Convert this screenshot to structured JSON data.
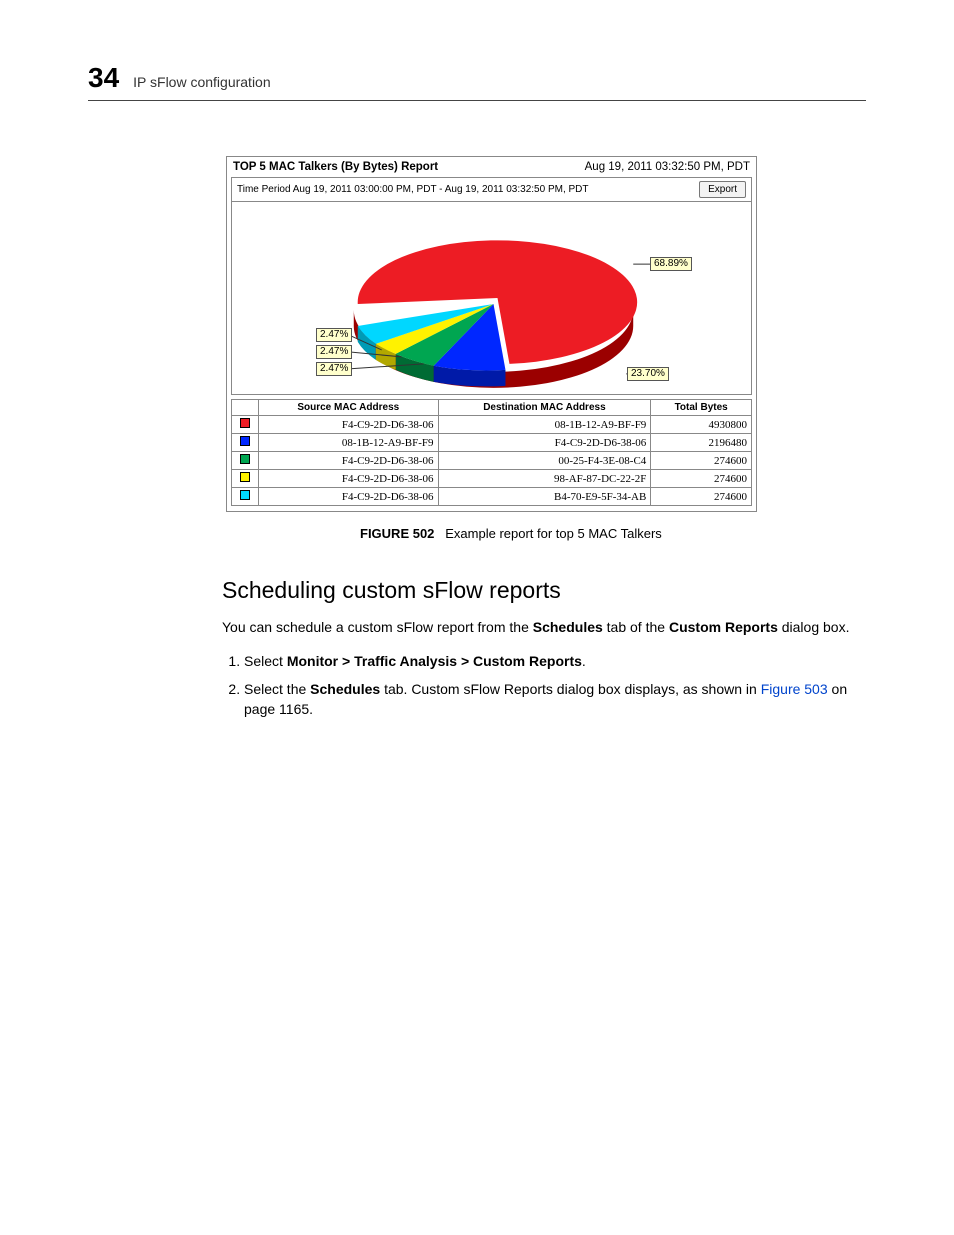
{
  "header": {
    "chapter": "34",
    "title": "IP sFlow configuration"
  },
  "report": {
    "title": "TOP 5 MAC Talkers (By Bytes) Report",
    "timestamp": "Aug 19, 2011 03:32:50 PM, PDT",
    "period": "Time Period Aug 19, 2011 03:00:00 PM, PDT - Aug 19, 2011 03:32:50 PM, PDT",
    "export": "Export"
  },
  "chart_data": {
    "type": "pie",
    "title": "TOP 5 MAC Talkers (By Bytes) Report",
    "slices": [
      {
        "label": "68.89%",
        "value": 68.89,
        "color": "#ed1c24"
      },
      {
        "label": "23.70%",
        "value": 23.7,
        "color": "#0027ff"
      },
      {
        "label": "2.47%",
        "value": 2.47,
        "color": "#00a651"
      },
      {
        "label": "2.47%",
        "value": 2.47,
        "color": "#fff200"
      },
      {
        "label": "2.47%",
        "value": 2.47,
        "color": "#00d7ff"
      }
    ],
    "legend": [
      "68.89%",
      "23.70%",
      "2.47%",
      "2.47%",
      "2.47%"
    ]
  },
  "table": {
    "headers": [
      "Source MAC Address",
      "Destination MAC Address",
      "Total Bytes"
    ],
    "rows": [
      {
        "swatch": "#ed1c24",
        "src": "F4-C9-2D-D6-38-06",
        "dst": "08-1B-12-A9-BF-F9",
        "bytes": "4930800"
      },
      {
        "swatch": "#0027ff",
        "src": "08-1B-12-A9-BF-F9",
        "dst": "F4-C9-2D-D6-38-06",
        "bytes": "2196480"
      },
      {
        "swatch": "#00a651",
        "src": "F4-C9-2D-D6-38-06",
        "dst": "00-25-F4-3E-08-C4",
        "bytes": "274600"
      },
      {
        "swatch": "#fff200",
        "src": "F4-C9-2D-D6-38-06",
        "dst": "98-AF-87-DC-22-2F",
        "bytes": "274600"
      },
      {
        "swatch": "#00d7ff",
        "src": "F4-C9-2D-D6-38-06",
        "dst": "B4-70-E9-5F-34-AB",
        "bytes": "274600"
      }
    ]
  },
  "caption": {
    "label": "FIGURE 502",
    "text": "Example report for top 5 MAC Talkers"
  },
  "section": {
    "heading": "Scheduling custom sFlow reports",
    "intro_pre": "You can schedule a custom sFlow report from the ",
    "intro_b1": "Schedules",
    "intro_mid": " tab of the ",
    "intro_b2": "Custom Reports",
    "intro_post": " dialog box.",
    "step1_pre": "Select ",
    "step1_b": "Monitor > Traffic Analysis > Custom Reports",
    "step1_post": ".",
    "step2_pre": "Select the ",
    "step2_b": "Schedules",
    "step2_mid": " tab. Custom sFlow Reports dialog box displays, as shown in ",
    "step2_link": "Figure 503",
    "step2_post": " on page 1165."
  }
}
